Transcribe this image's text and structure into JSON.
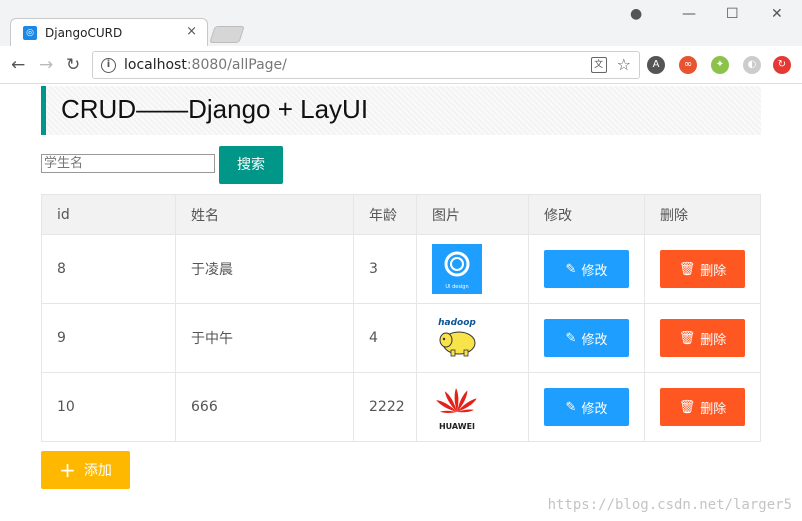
{
  "browser": {
    "tab_title": "DjangoCURD",
    "tab_close": "×",
    "url_host": "localhost",
    "url_path": ":8080/allPage/",
    "window_controls": {
      "minimize": "—",
      "maximize": "☐",
      "close": "✕"
    },
    "extensions": [
      {
        "icon": "angular-icon",
        "label": "A",
        "color": "#555555"
      },
      {
        "icon": "infinity-icon",
        "label": "∞",
        "color": "#e8542f"
      },
      {
        "icon": "tag-icon",
        "label": "✦",
        "color": "#8bc34a"
      },
      {
        "icon": "ghost-icon",
        "label": "◐",
        "color": "#cccccc"
      },
      {
        "icon": "refresh-icon",
        "label": "↻",
        "color": "#e53935"
      }
    ]
  },
  "page": {
    "title": "CRUD——Django + LayUI",
    "search": {
      "placeholder": "学生名",
      "button_label": "搜索"
    },
    "table": {
      "columns": [
        "id",
        "姓名",
        "年龄",
        "图片",
        "修改",
        "删除"
      ],
      "rows": [
        {
          "id": "8",
          "name": "于凌晨",
          "age": "3",
          "image": "ui-design-logo"
        },
        {
          "id": "9",
          "name": "于中午",
          "age": "4",
          "image": "hadoop-logo"
        },
        {
          "id": "10",
          "name": "666",
          "age": "2222",
          "image": "huawei-logo"
        }
      ],
      "edit_label": "修改",
      "delete_label": "删除"
    },
    "add_label": "添加",
    "watermark": "https://blog.csdn.net/larger5",
    "logo_text": {
      "ui": "UI design",
      "hadoop": "hadoop",
      "huawei": "HUAWEI"
    },
    "colors": {
      "accent": "#009688",
      "edit": "#1e9fff",
      "delete": "#ff5722",
      "add": "#ffb800"
    }
  }
}
